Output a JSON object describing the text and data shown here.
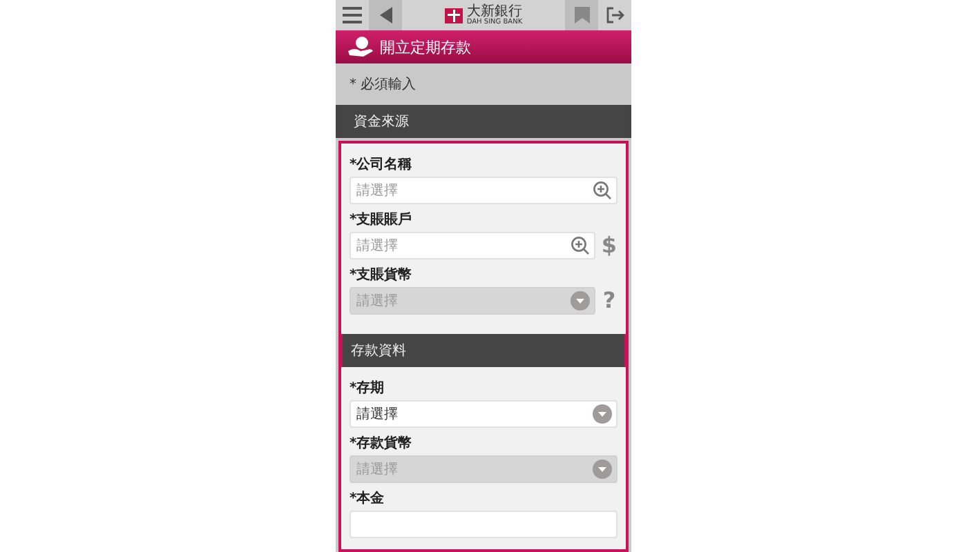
{
  "header": {
    "bank_name_zh": "大新銀行",
    "bank_name_en": "DAH SING BANK"
  },
  "title": "開立定期存款",
  "required_note": "* 必須輸入",
  "sections": [
    {
      "heading": "資金來源",
      "fields": [
        {
          "label": "*公司名稱",
          "kind": "search",
          "placeholder": "請選擇",
          "disabled": false
        },
        {
          "label": "*支賬賬戶",
          "kind": "search",
          "placeholder": "請選擇",
          "disabled": false,
          "side_icon": "$"
        },
        {
          "label": "*支賬貨幣",
          "kind": "select",
          "placeholder": "請選擇",
          "disabled": true,
          "side_icon": "?"
        }
      ]
    },
    {
      "heading": "存款資料",
      "fields": [
        {
          "label": "*存期",
          "kind": "select",
          "placeholder": "請選擇",
          "disabled": false
        },
        {
          "label": "*存款貨幣",
          "kind": "select",
          "placeholder": "請選擇",
          "disabled": true
        },
        {
          "label": "*本金",
          "kind": "text",
          "disabled": false
        }
      ]
    }
  ]
}
